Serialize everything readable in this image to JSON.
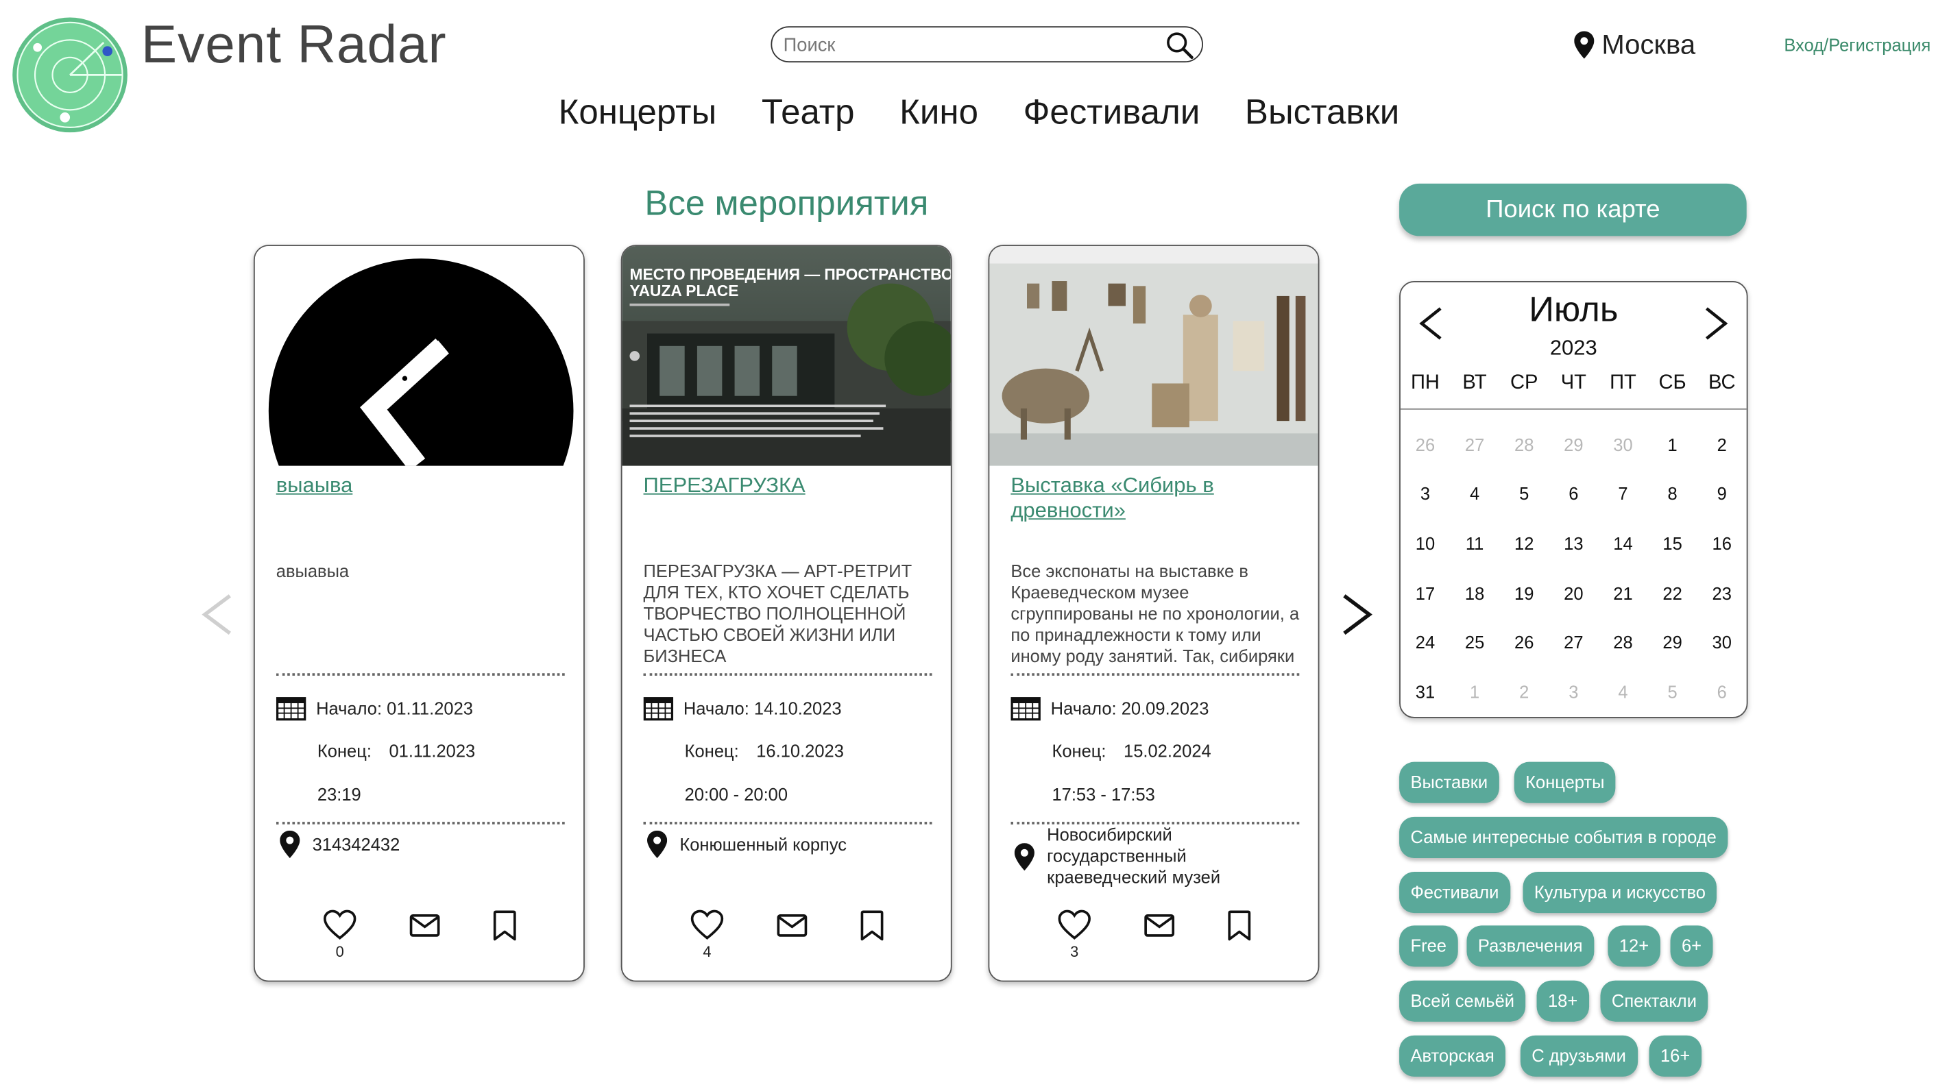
{
  "header": {
    "brand": "Event Radar",
    "search_placeholder": "Поиск",
    "city": "Москва",
    "login": "Вход/Регистрация",
    "nav": [
      "Концерты",
      "Театр",
      "Кино",
      "Фестивали",
      "Выставки"
    ]
  },
  "main": {
    "section_title": "Все мероприятия",
    "cards": [
      {
        "title": "выаыва",
        "description": "авыавыа",
        "start_label": "Начало:",
        "start": "01.11.2023",
        "end_label": "Конец:",
        "end": "01.11.2023",
        "time": "23:19",
        "place": "314342432",
        "likes": "0"
      },
      {
        "title": "ПЕРЕЗАГРУЗКА",
        "description": "ПЕРЕЗАГРУЗКА — АРТ-РЕТРИТ ДЛЯ ТЕХ, КТО ХОЧЕТ СДЕЛАТЬ ТВОРЧЕСТВО ПОЛНОЦЕННОЙ ЧАСТЬЮ СВОЕЙ ЖИЗНИ ИЛИ БИЗНЕСА",
        "image_heading_1": "МЕСТО ПРОВЕДЕНИЯ — ПРОСТРАНСТВО",
        "image_heading_2": "YAUZA PLACE",
        "start_label": "Начало:",
        "start": "14.10.2023",
        "end_label": "Конец:",
        "end": "16.10.2023",
        "time": "20:00 - 20:00",
        "place": "Конюшенный корпус",
        "likes": "4"
      },
      {
        "title": "Выставка «Сибирь в древности»",
        "description": "Все экспонаты на выставке в Краеведческом музее сгруппированы не по хронологии, а по принадлежности к тому или иному роду занятий. Так, сибиряки",
        "start_label": "Начало:",
        "start": "20.09.2023",
        "end_label": "Конец:",
        "end": "15.02.2024",
        "time": "17:53 - 17:53",
        "place": "Новосибирский государственный краеведческий музей",
        "likes": "3"
      }
    ]
  },
  "sidebar": {
    "map_button": "Поиск по карте",
    "calendar": {
      "month": "Июль",
      "year": "2023",
      "weekdays": [
        "ПН",
        "ВТ",
        "СР",
        "ЧТ",
        "ПТ",
        "СБ",
        "ВС"
      ],
      "weeks": [
        [
          "26",
          "27",
          "28",
          "29",
          "30",
          "1",
          "2"
        ],
        [
          "3",
          "4",
          "5",
          "6",
          "7",
          "8",
          "9"
        ],
        [
          "10",
          "11",
          "12",
          "13",
          "14",
          "15",
          "16"
        ],
        [
          "17",
          "18",
          "19",
          "20",
          "21",
          "22",
          "23"
        ],
        [
          "24",
          "25",
          "26",
          "27",
          "28",
          "29",
          "30"
        ],
        [
          "31",
          "1",
          "2",
          "3",
          "4",
          "5",
          "6"
        ]
      ]
    },
    "tags": [
      "Выставки",
      "Концерты",
      "Самые интересные события в городе",
      "Фестивали",
      "Культура и искусство",
      "Free",
      "Развлечения",
      "12+",
      "6+",
      "Всей семьёй",
      "18+",
      "Спектакли",
      "Авторская",
      "С друзьями",
      "16+"
    ]
  },
  "colors": {
    "accent": "#5aa99a",
    "link": "#3a8a70",
    "logo_green": "#4ec277"
  }
}
